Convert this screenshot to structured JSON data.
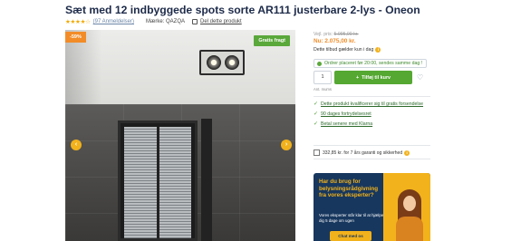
{
  "product": {
    "title": "Sæt med 12 indbyggede spots sorte AR111 justerbare 2-lys - Oneon",
    "stars": "★★★★☆",
    "reviews_label": "(97 Anmeldelser)",
    "brand_label": "Mærke: QAZQA",
    "share_label": "Del dette produkt",
    "discount_badge": "-59%",
    "shipping_badge": "Gratis fragt"
  },
  "price": {
    "was_label": "Vejl. pris:",
    "was_value": "5.095,00 kr.",
    "now_label": "Nu: 2.075,00 kr.",
    "offer_text": "Dette tilbud gælder kun i dag",
    "info_symbol": "i"
  },
  "stock": {
    "text": "Ordrer placeret før 20:00, sendes samme dag !"
  },
  "cart": {
    "quantity": "1",
    "quantity_label": "Ant. mums",
    "add_label": "Tilføj til kurv",
    "plus_symbol": "+",
    "heart_symbol": "♡"
  },
  "benefits": [
    "Dette produkt kvalificerer sig til gratis forsendelse",
    "90 dages fortrydelsesret",
    "Betal senere med Klarna"
  ],
  "check_symbol": "✓",
  "insurance": {
    "text": "332,85 kr. for 7 års garanti og sikkerhed",
    "info_symbol": "i"
  },
  "advisor": {
    "title": "Har du brug for belysningsrådgivning fra vores eksperter?",
    "text": "Vores eksperter står klar til at hjælpe dig 5 dage om ugen",
    "chat_label": "Chat med os"
  },
  "image": {
    "prev_symbol": "‹",
    "next_symbol": "›"
  },
  "colors": {
    "title": "#1d2b4a",
    "accent_orange": "#f28c28",
    "accent_yellow": "#f2b21c",
    "green": "#55a832",
    "advisor_bg": "#17375e"
  }
}
